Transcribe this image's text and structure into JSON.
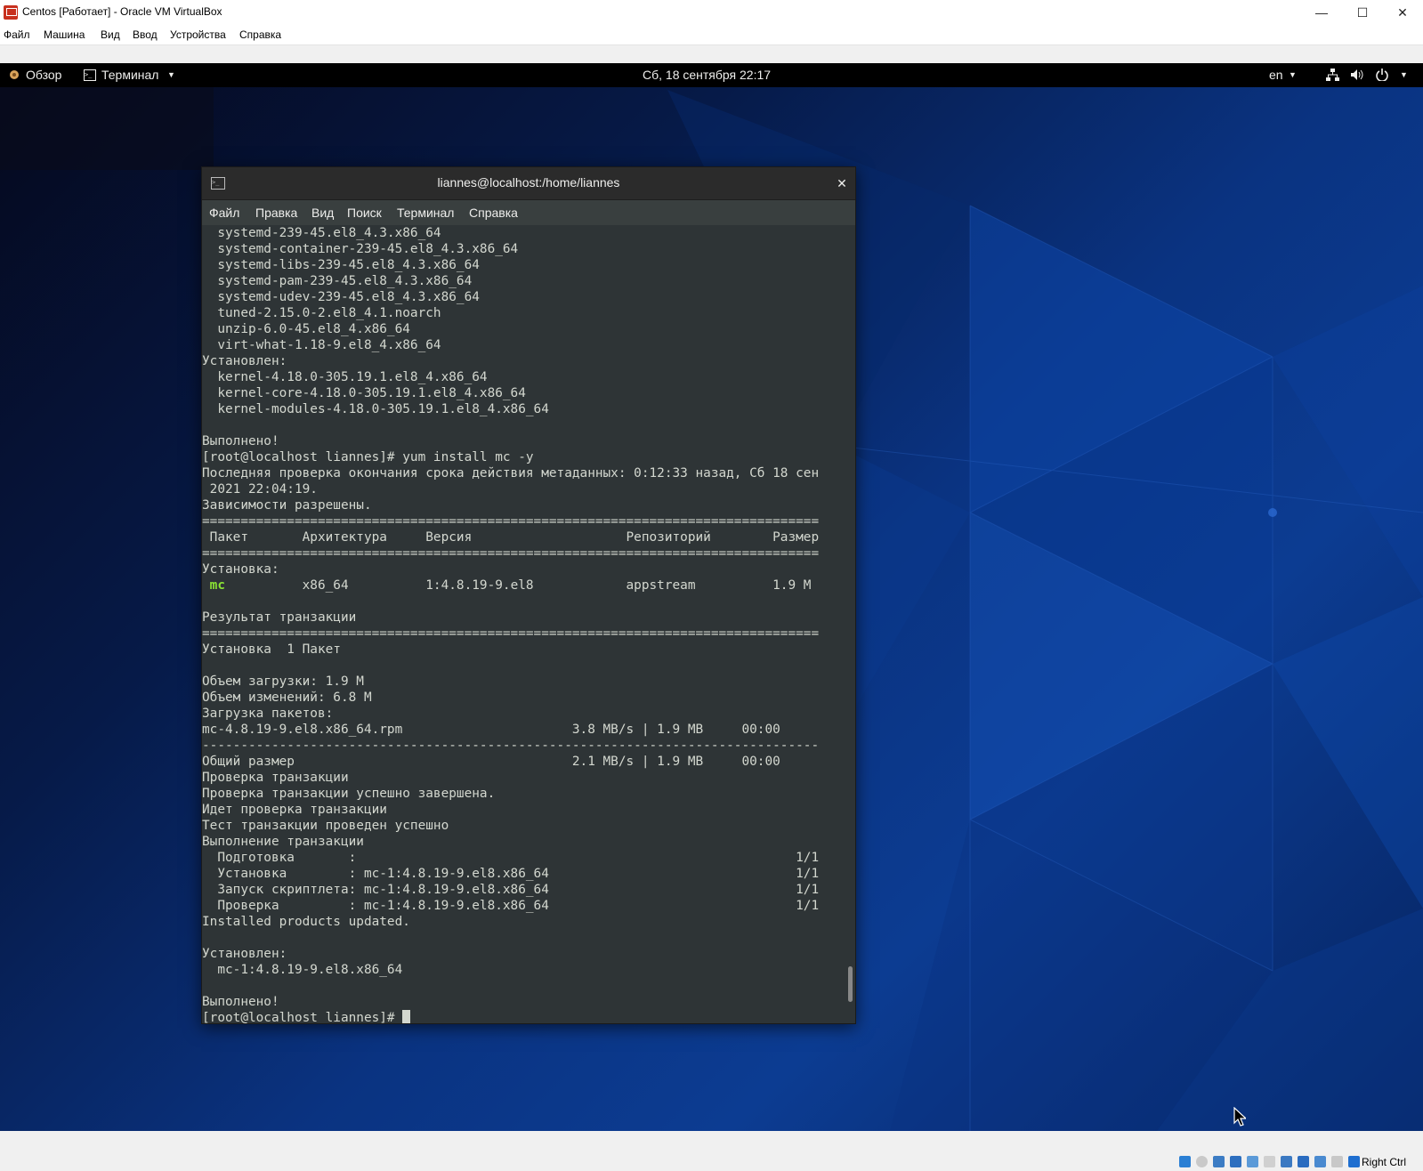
{
  "window": {
    "title": "Centos [Работает] - Oracle VM VirtualBox",
    "menu": [
      "Файл",
      "Машина",
      "Вид",
      "Ввод",
      "Устройства",
      "Справка"
    ]
  },
  "gnome": {
    "activities": "Обзор",
    "app_menu": "Терминал",
    "clock": "Сб, 18 сентября  22:17",
    "keyboard_layout": "en"
  },
  "terminal": {
    "title": "liannes@localhost:/home/liannes",
    "menu": [
      "Файл",
      "Правка",
      "Вид",
      "Поиск",
      "Терминал",
      "Справка"
    ],
    "lines": [
      "  systemd-239-45.el8_4.3.x86_64",
      "  systemd-container-239-45.el8_4.3.x86_64",
      "  systemd-libs-239-45.el8_4.3.x86_64",
      "  systemd-pam-239-45.el8_4.3.x86_64",
      "  systemd-udev-239-45.el8_4.3.x86_64",
      "  tuned-2.15.0-2.el8_4.1.noarch",
      "  unzip-6.0-45.el8_4.x86_64",
      "  virt-what-1.18-9.el8_4.x86_64",
      "Установлен:",
      "  kernel-4.18.0-305.19.1.el8_4.x86_64",
      "  kernel-core-4.18.0-305.19.1.el8_4.x86_64",
      "  kernel-modules-4.18.0-305.19.1.el8_4.x86_64",
      "",
      "Выполнено!",
      "[root@localhost liannes]# yum install mc -y",
      "Последняя проверка окончания срока действия метаданных: 0:12:33 назад, Сб 18 сен",
      " 2021 22:04:19.",
      "Зависимости разрешены.",
      "================================================================================",
      " Пакет       Архитектура     Версия                    Репозиторий        Размер",
      "================================================================================",
      "Установка:",
      " mc          x86_64          1:4.8.19-9.el8            appstream          1.9 M",
      "",
      "Результат транзакции",
      "================================================================================",
      "Установка  1 Пакет",
      "",
      "Объем загрузки: 1.9 M",
      "Объем изменений: 6.8 M",
      "Загрузка пакетов:",
      "mc-4.8.19-9.el8.x86_64.rpm                      3.8 MB/s | 1.9 MB     00:00",
      "--------------------------------------------------------------------------------",
      "Общий размер                                    2.1 MB/s | 1.9 MB     00:00",
      "Проверка транзакции",
      "Проверка транзакции успешно завершена.",
      "Идет проверка транзакции",
      "Тест транзакции проведен успешно",
      "Выполнение транзакции",
      "  Подготовка       :                                                         1/1",
      "  Установка        : mc-1:4.8.19-9.el8.x86_64                                1/1",
      "  Запуск скриптлета: mc-1:4.8.19-9.el8.x86_64                                1/1",
      "  Проверка         : mc-1:4.8.19-9.el8.x86_64                                1/1",
      "Installed products updated.",
      "",
      "Установлен:",
      "  mc-1:4.8.19-9.el8.x86_64",
      "",
      "Выполнено!",
      "[root@localhost liannes]# "
    ]
  },
  "statusbar": {
    "host_key": "Right Ctrl"
  }
}
